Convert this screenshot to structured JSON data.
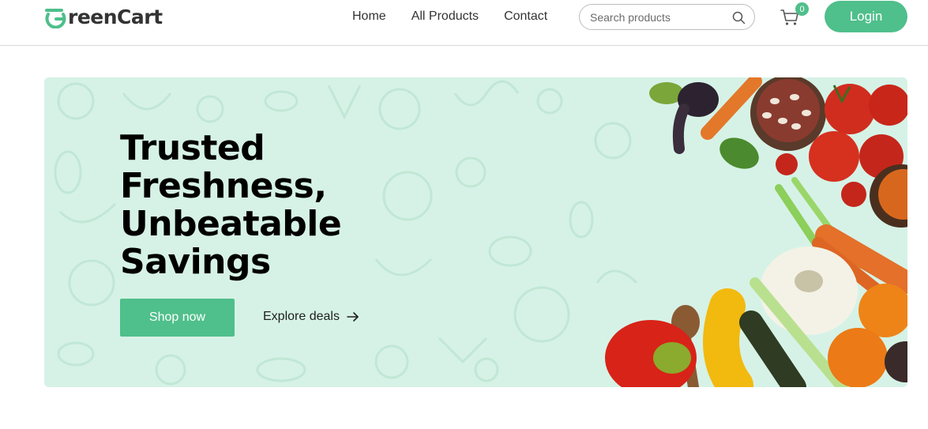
{
  "brand": {
    "name": "GreenCart",
    "name_rest": "reenCart",
    "accent_color": "#4fbf8b"
  },
  "nav": {
    "links": [
      "Home",
      "All Products",
      "Contact"
    ]
  },
  "search": {
    "placeholder": "Search products",
    "icon": "search-icon"
  },
  "cart": {
    "icon": "cart-icon",
    "count": "0"
  },
  "login": {
    "label": "Login"
  },
  "hero": {
    "title_lines": [
      "Trusted",
      "Freshness,",
      "Unbeatable",
      "Savings"
    ],
    "cta_primary": "Shop now",
    "cta_secondary": "Explore deals",
    "background_color": "#d6f2e6"
  }
}
